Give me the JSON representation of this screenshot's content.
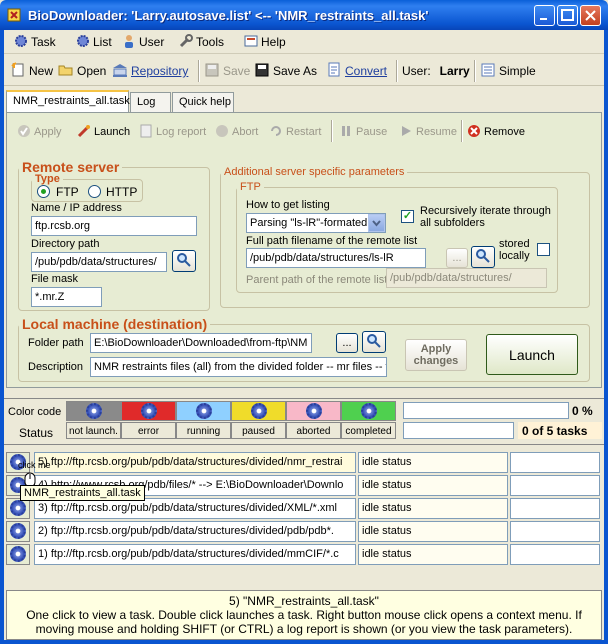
{
  "window": {
    "title": "BioDownloader: 'Larry.autosave.list' <-- 'NMR_restraints_all.task'"
  },
  "menu": [
    {
      "label": "Task",
      "icon": "task-icon"
    },
    {
      "label": "List",
      "icon": "list-icon"
    },
    {
      "label": "User",
      "icon": "user-icon"
    },
    {
      "label": "Tools",
      "icon": "tools-icon"
    },
    {
      "label": "Help",
      "icon": "help-icon"
    }
  ],
  "toolbar": {
    "new": "New",
    "open": "Open",
    "repository": "Repository",
    "save": "Save",
    "save_as": "Save As",
    "convert": "Convert",
    "user_label": "User:",
    "user_name": "Larry",
    "simple": "Simple"
  },
  "tabs": [
    "NMR_restraints_all.task",
    "Log",
    "Quick help"
  ],
  "subtoolbar": {
    "apply": "Apply",
    "launch": "Launch",
    "log_report": "Log report",
    "abort": "Abort",
    "restart": "Restart",
    "pause": "Pause",
    "resume": "Resume",
    "remove": "Remove"
  },
  "remote": {
    "legend": "Remote server",
    "type_legend": "Type",
    "ftp": "FTP",
    "http": "HTTP",
    "name_label": "Name / IP address",
    "name_value": "ftp.rcsb.org",
    "dir_label": "Directory path",
    "dir_value": "/pub/pdb/data/structures/",
    "mask_label": "File mask",
    "mask_value": "*.mr.Z"
  },
  "additional": {
    "legend": "Additional server specific parameters",
    "ftp_legend": "FTP",
    "how_label": "How to get listing",
    "how_value": "Parsing \"ls-lR\"-formated",
    "recursive_label": "Recursively iterate through all subfolders",
    "full_path_label": "Full path filename of the remote list",
    "full_path_value": "/pub/pdb/data/structures/ls-lR",
    "stored_label": "stored locally",
    "parent_label": "Parent path of the remote list",
    "parent_value": "/pub/pdb/data/structures/",
    "dots": "..."
  },
  "local": {
    "legend": "Local machine (destination)",
    "folder_label": "Folder path",
    "folder_value": "E:\\BioDownloader\\Downloaded\\from-ftp\\NM",
    "desc_label": "Description",
    "desc_value": "NMR restraints files (all) from the divided folder -- mr files -- ftp.r",
    "dots": "...",
    "apply_changes": "Apply changes",
    "launch": "Launch"
  },
  "colorcode": {
    "label": "Color code",
    "status_label": "Status",
    "states": [
      {
        "name": "not launch.",
        "color": "#8a8a8a"
      },
      {
        "name": "error",
        "color": "#e02a2a"
      },
      {
        "name": "running",
        "color": "#8fd0ff"
      },
      {
        "name": "paused",
        "color": "#f0dc2a"
      },
      {
        "name": "aborted",
        "color": "#f8b8c8"
      },
      {
        "name": "completed",
        "color": "#4fd04f"
      }
    ],
    "percent": "0 %",
    "summary": "0 of 5 tasks"
  },
  "tasks": [
    {
      "text": "5)  ftp://ftp.rcsb.org/pub/pdb/data/structures/divided/nmr_restrai",
      "status": "idle status",
      "highlight": true
    },
    {
      "text": "4)  http://www.rcsb.org/pdb/files/* --> E:\\BioDownloader\\Downlo",
      "status": "idle status",
      "highlight": false
    },
    {
      "text": "3)  ftp://ftp.rcsb.org/pub/pdb/data/structures/divided/XML/*.xml",
      "status": "idle status",
      "highlight": false
    },
    {
      "text": "2)  ftp://ftp.rcsb.org/pub/pdb/data/structures/divided/pdb/pdb*.",
      "status": "idle status",
      "highlight": false
    },
    {
      "text": "1)  ftp://ftp.rcsb.org/pub/pdb/data/structures/divided/mmCIF/*.c",
      "status": "idle status",
      "highlight": false
    }
  ],
  "tooltip": {
    "click": "click me",
    "text": "NMR_restraints_all.task"
  },
  "statusbar": {
    "title": "5) \"NMR_restraints_all.task\"",
    "text": "One click to view a task. Double click launches a task. Right button mouse click opens a context menu. If moving mouse and holding SHIFT (or CTRL) a log report is shown (or you view the task parameters)."
  }
}
